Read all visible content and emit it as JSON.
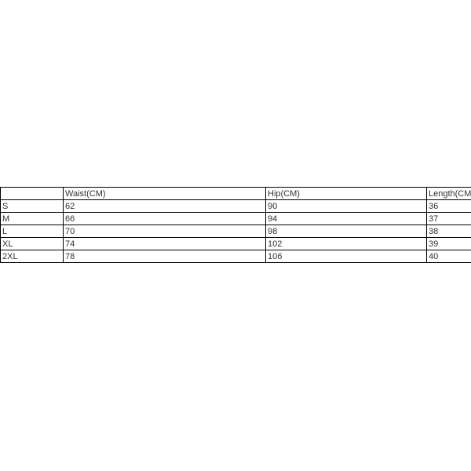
{
  "table": {
    "headers": {
      "size": "",
      "waist": "Waist(CM)",
      "hip": "Hip(CM)",
      "length": "Length(CM)"
    },
    "rows": [
      {
        "size": "S",
        "waist": "62",
        "hip": "90",
        "length": "36"
      },
      {
        "size": "M",
        "waist": "66",
        "hip": "94",
        "length": "37"
      },
      {
        "size": "L",
        "waist": "70",
        "hip": "98",
        "length": "38"
      },
      {
        "size": "XL",
        "waist": "74",
        "hip": "102",
        "length": "39"
      },
      {
        "size": "2XL",
        "waist": "78",
        "hip": "106",
        "length": "40"
      }
    ]
  }
}
